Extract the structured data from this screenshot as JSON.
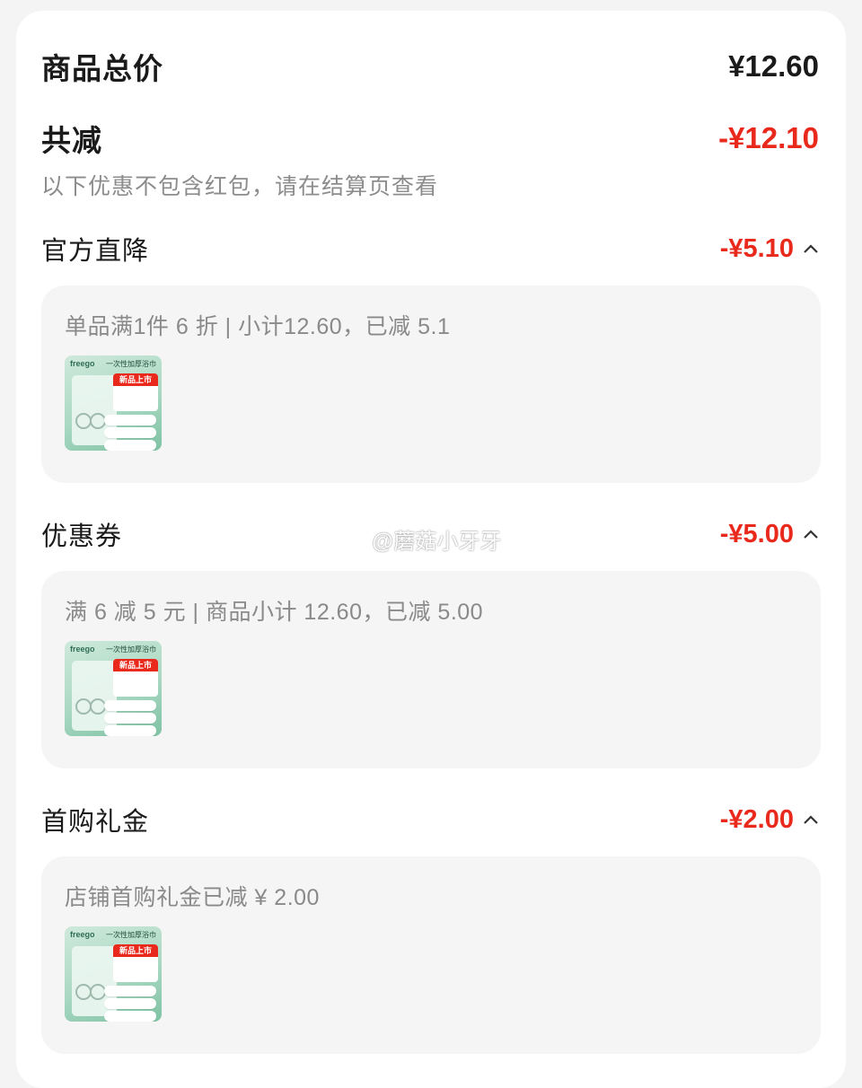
{
  "summary": {
    "total_label": "商品总价",
    "total_value": "¥12.60",
    "discount_label": "共减",
    "discount_value": "-¥12.10",
    "note": "以下优惠不包含红包，请在结算页查看"
  },
  "sections": [
    {
      "title": "官方直降",
      "amount": "-¥5.10",
      "detail": "单品满1件 6 折 | 小计12.60，已减 5.1"
    },
    {
      "title": "优惠券",
      "amount": "-¥5.00",
      "detail": "满 6 减 5 元 | 商品小计 12.60，已减 5.00"
    },
    {
      "title": "首购礼金",
      "amount": "-¥2.00",
      "detail": "店铺首购礼金已减 ¥ 2.00"
    }
  ],
  "thumbnail": {
    "brand": "freego",
    "label": "一次性加厚浴巾",
    "badge": "新品上市"
  },
  "watermark": "@蘑菇小牙牙",
  "colors": {
    "accent_red": "#e8291c",
    "muted_text": "#8c8c8c",
    "panel_bg": "#f5f5f5"
  }
}
